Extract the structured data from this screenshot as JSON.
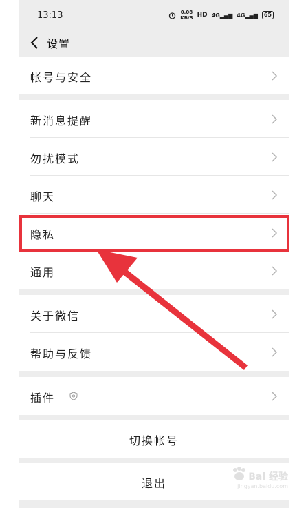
{
  "status_bar": {
    "time": "13:13",
    "net_speed_value": "0.08",
    "net_speed_unit": "KB/S",
    "hd": "HD",
    "sig1": "4G",
    "sig2": "4G",
    "battery": "65"
  },
  "header": {
    "title": "设置"
  },
  "menu": {
    "account_security": "帐号与安全",
    "new_message_alert": "新消息提醒",
    "do_not_disturb": "勿扰模式",
    "chat": "聊天",
    "privacy": "隐私",
    "general": "通用",
    "about_wechat": "关于微信",
    "help_feedback": "帮助与反馈",
    "plugins": "插件"
  },
  "actions": {
    "switch_account": "切换帐号",
    "logout": "退出"
  },
  "annotation": {
    "color": "#e8333c"
  },
  "watermark": {
    "text": "Bai 经验",
    "url": "jingyan.baidu.com"
  }
}
